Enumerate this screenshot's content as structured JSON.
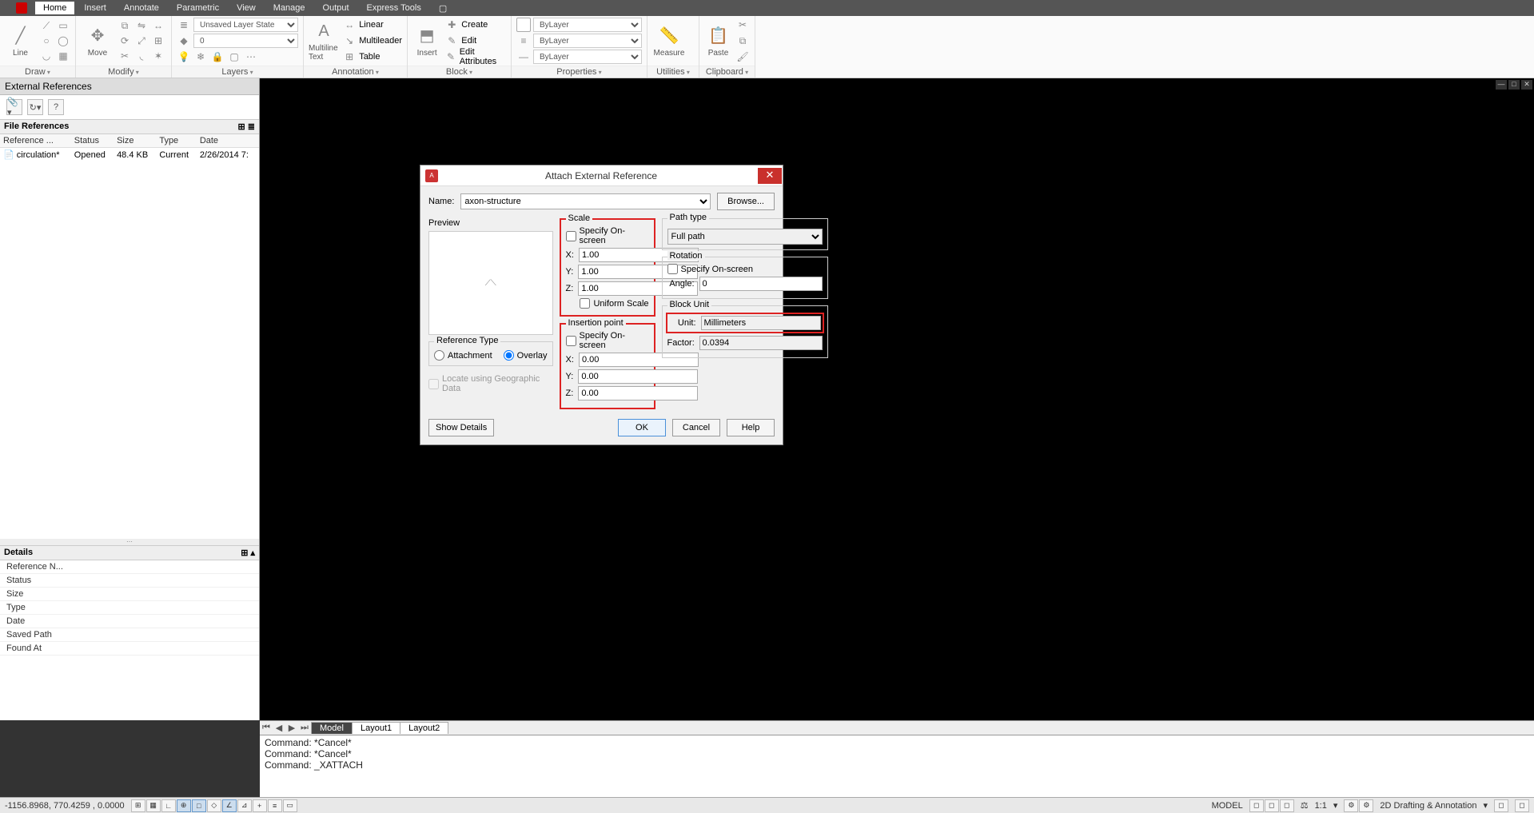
{
  "menu": {
    "tabs": [
      "Home",
      "Insert",
      "Annotate",
      "Parametric",
      "View",
      "Manage",
      "Output",
      "Express Tools"
    ],
    "active": 0
  },
  "ribbon": {
    "panels": {
      "draw": {
        "title": "Draw",
        "large": "Line"
      },
      "modify": {
        "title": "Modify",
        "large": "Move"
      },
      "layers": {
        "title": "Layers",
        "state": "Unsaved Layer State",
        "current": "0"
      },
      "annotation": {
        "title": "Annotation",
        "large": "Multiline Text",
        "linear": "Linear",
        "mleader": "Multileader",
        "table": "Table"
      },
      "block": {
        "title": "Block",
        "large": "Insert",
        "create": "Create",
        "edit": "Edit",
        "editattr": "Edit Attributes"
      },
      "properties": {
        "title": "Properties",
        "bylayer": "ByLayer"
      },
      "utilities": {
        "title": "Utilities",
        "large": "Measure"
      },
      "clipboard": {
        "title": "Clipboard",
        "large": "Paste"
      }
    }
  },
  "xref": {
    "title": "External References",
    "section": "File References",
    "cols": [
      "Reference ...",
      "Status",
      "Size",
      "Type",
      "Date"
    ],
    "rows": [
      {
        "name": "circulation*",
        "status": "Opened",
        "size": "48.4 KB",
        "type": "Current",
        "date": "2/26/2014 7:"
      }
    ],
    "details_title": "Details",
    "details": [
      "Reference N...",
      "Status",
      "Size",
      "Type",
      "Date",
      "Saved Path",
      "Found At"
    ]
  },
  "layout": {
    "tabs": [
      "Model",
      "Layout1",
      "Layout2"
    ],
    "active": 0
  },
  "cmd": {
    "lines": [
      "Command: *Cancel*",
      "Command: *Cancel*",
      "Command: _XATTACH"
    ]
  },
  "status": {
    "coords": "-1156.8968, 770.4259 , 0.0000",
    "model": "MODEL",
    "scale": "1:1",
    "workspace": "2D Drafting & Annotation"
  },
  "dialog": {
    "title": "Attach External Reference",
    "name_label": "Name:",
    "name_value": "axon-structure",
    "browse": "Browse...",
    "preview": "Preview",
    "reference_type": {
      "title": "Reference Type",
      "attachment": "Attachment",
      "overlay": "Overlay",
      "selected": "overlay"
    },
    "locate_geo": "Locate using Geographic Data",
    "scale": {
      "title": "Scale",
      "specify": "Specify On-screen",
      "x": "1.00",
      "y": "1.00",
      "z": "1.00",
      "uniform": "Uniform Scale"
    },
    "insertion": {
      "title": "Insertion point",
      "specify": "Specify On-screen",
      "x": "0.00",
      "y": "0.00",
      "z": "0.00"
    },
    "path": {
      "title": "Path type",
      "value": "Full path"
    },
    "rotation": {
      "title": "Rotation",
      "specify": "Specify On-screen",
      "angle_label": "Angle:",
      "angle": "0"
    },
    "block_unit": {
      "title": "Block Unit",
      "unit_label": "Unit:",
      "unit": "Millimeters",
      "factor_label": "Factor:",
      "factor": "0.0394"
    },
    "buttons": {
      "show_details": "Show Details",
      "ok": "OK",
      "cancel": "Cancel",
      "help": "Help"
    }
  }
}
